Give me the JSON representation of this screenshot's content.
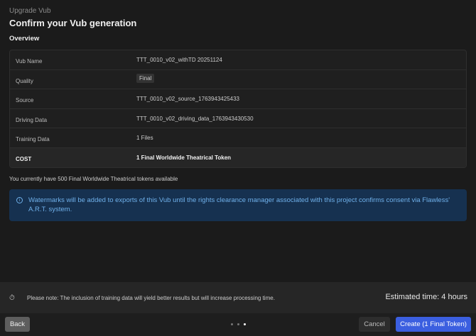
{
  "header": {
    "breadcrumb": "Upgrade Vub",
    "title": "Confirm your Vub generation",
    "section": "Overview"
  },
  "overview": [
    {
      "label": "Vub Name",
      "value": "TTT_0010_v02_withTD 20251124"
    },
    {
      "label": "Quality",
      "value": "Final"
    },
    {
      "label": "Source",
      "value": "TTT_0010_v02_source_1763943425433"
    },
    {
      "label": "Driving Data",
      "value": "TTT_0010_v02_driving_data_1763943430530"
    },
    {
      "label": "Training Data",
      "value": "1 Files"
    },
    {
      "label": "COST",
      "value": "1 Final Worldwide Theatrical Token"
    }
  ],
  "available": "You currently have 500 Final Worldwide Theatrical tokens available",
  "info": {
    "icon": "info-icon",
    "text": "Watermarks will be added to exports of this Vub until the rights clearance manager associated with this project confirms consent via Flawless' A.R.T. system."
  },
  "note": {
    "icon": "stopwatch-icon",
    "text": "Please note: The inclusion of training data will yield better results but will increase processing time.",
    "estimate": "Estimated time: 4 hours"
  },
  "footer": {
    "back": "Back",
    "cancel": "Cancel",
    "create": "Create (1 Final Token)",
    "step": 3,
    "steps": 3
  },
  "colors": {
    "accent": "#3b5fe0",
    "info_bg": "#163150",
    "info_text": "#6fb0ea"
  }
}
